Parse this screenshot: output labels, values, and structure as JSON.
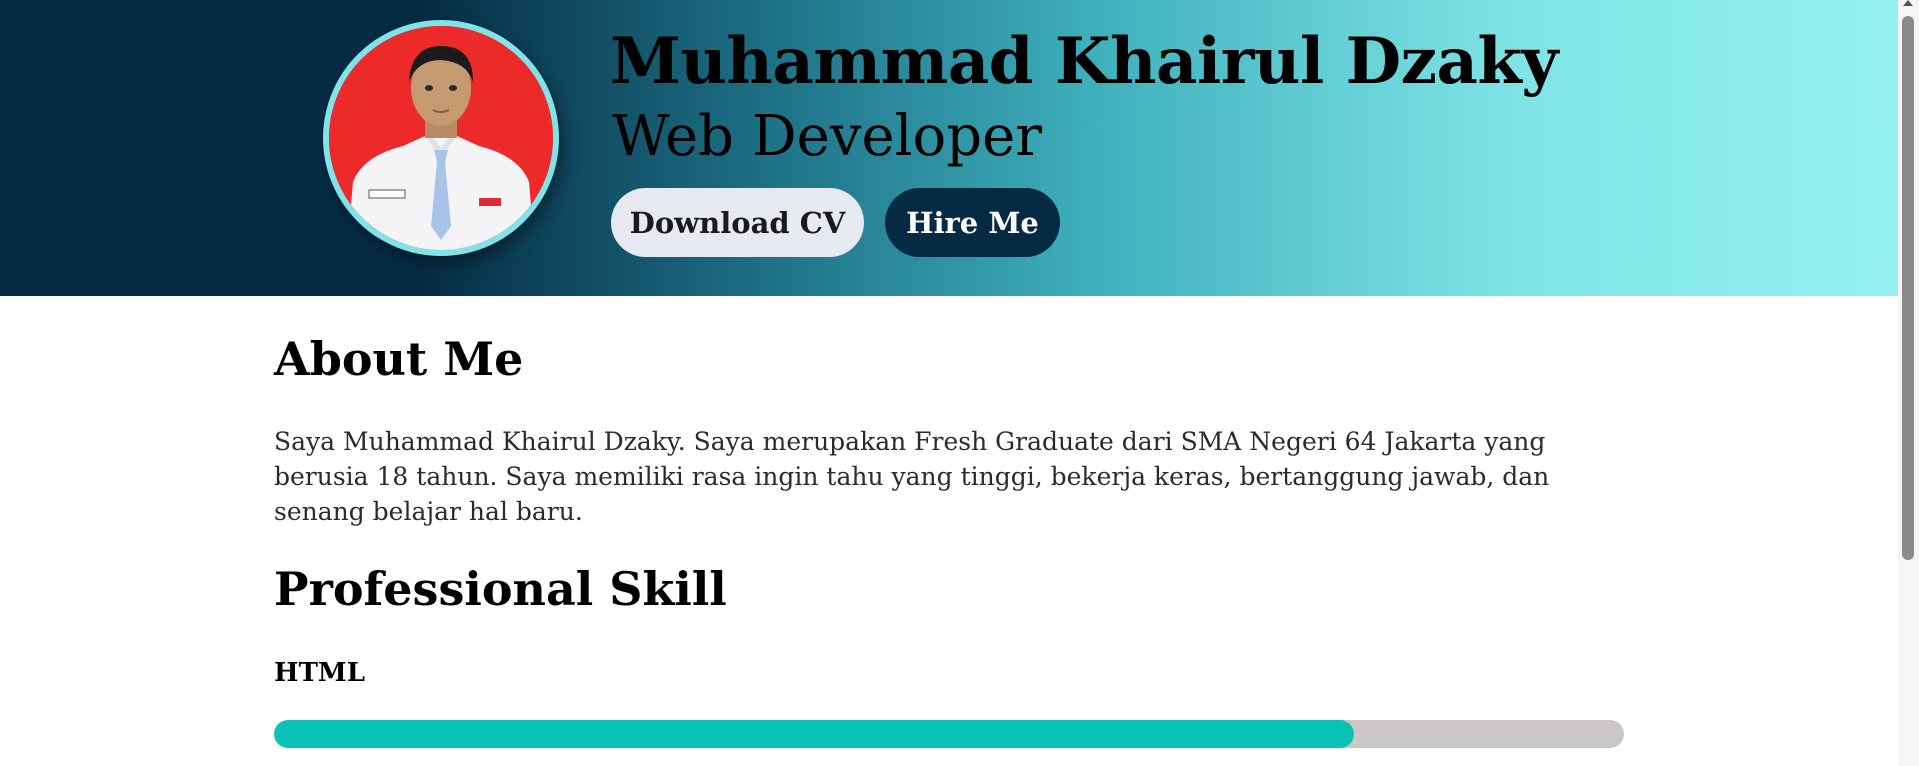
{
  "header": {
    "name": "Muhammad Khairul Dzaky",
    "role": "Web Developer",
    "download_label": "Download CV",
    "hire_label": "Hire Me"
  },
  "about": {
    "title": "About Me",
    "text": "Saya Muhammad Khairul Dzaky. Saya merupakan Fresh Graduate dari SMA Negeri 64 Jakarta yang berusia 18 tahun. Saya memiliki rasa ingin tahu yang tinggi, bekerja keras, bertanggung jawab, dan senang belajar hal baru."
  },
  "skills": {
    "title": "Professional Skill",
    "items": [
      {
        "name": "HTML",
        "level_percent": 80
      }
    ]
  },
  "colors": {
    "hero_dark": "#052a43",
    "hero_light": "#95f1f1",
    "avatar_background": "#ec2a2a",
    "avatar_ring": "#7fe3e8",
    "button_light": "#e6e9ef",
    "button_dark": "#052a43",
    "progress_fill": "#0bc2b8",
    "progress_track": "#cbc7c7"
  }
}
